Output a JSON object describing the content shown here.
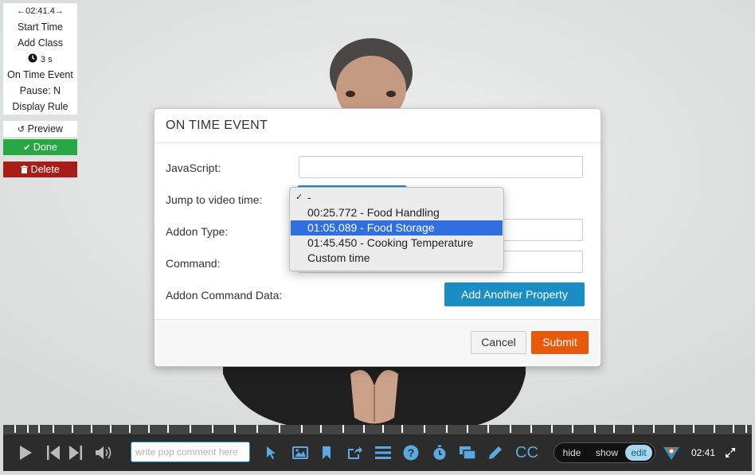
{
  "left_panel": {
    "duration": "←02:41.4→",
    "start_time": "Start Time",
    "add_class": "Add Class",
    "seconds": "3 s",
    "on_time_event": "On Time Event",
    "pause": "Pause: N",
    "display_rule": "Display Rule",
    "preview": "Preview",
    "done": "Done",
    "delete": "Delete"
  },
  "modal": {
    "title": "ON TIME EVENT",
    "javascript_label": "JavaScript:",
    "jump_label": "Jump to video time:",
    "addon_type_label": "Addon Type:",
    "command_label": "Command:",
    "addon_data_label": "Addon Command Data:",
    "add_property": "Add Another Property",
    "cancel": "Cancel",
    "submit": "Submit",
    "javascript_value": "",
    "addon_type_value": "",
    "command_value": ""
  },
  "dropdown": {
    "options": [
      "-",
      "00:25.772 - Food Handling",
      "01:05.089 - Food Storage",
      "01:45.450 - Cooking Temperature",
      "Custom time"
    ],
    "checked_index": 0,
    "highlighted_index": 2
  },
  "controls": {
    "comment_placeholder": "write pop comment here",
    "cc": "CC",
    "hide": "hide",
    "show": "show",
    "edit": "edit",
    "active_mode": "edit",
    "time": "02:41"
  },
  "colors": {
    "accent_blue": "#1a8ec4",
    "submit_orange": "#e8590c",
    "done_green": "#27a844",
    "delete_red": "#a81d17",
    "selection_blue": "#2f6fe0"
  }
}
